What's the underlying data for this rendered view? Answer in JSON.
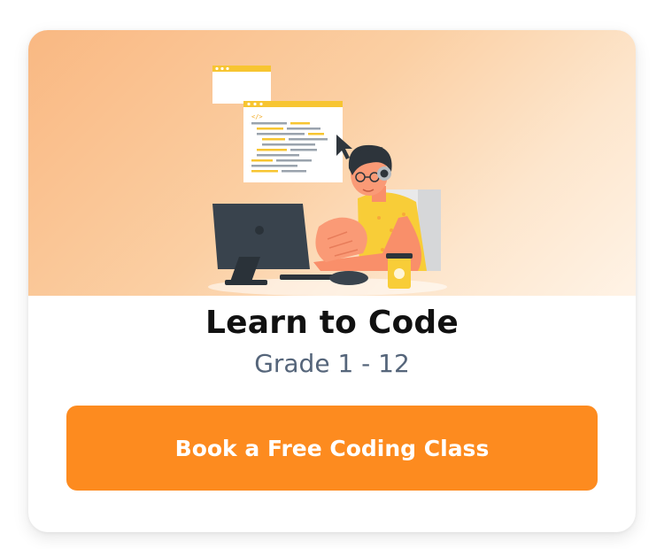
{
  "card": {
    "title": "Learn to Code",
    "subtitle": "Grade 1 - 12",
    "cta_label": "Book a Free Coding Class"
  },
  "illustration": {
    "icon": "person-coding-illustration",
    "code_tag": "</>"
  },
  "colors": {
    "accent": "#fd8b1f",
    "title": "#111111",
    "subtitle": "#55657a",
    "banner_start": "#f9b882",
    "banner_end": "#fff3e6"
  }
}
